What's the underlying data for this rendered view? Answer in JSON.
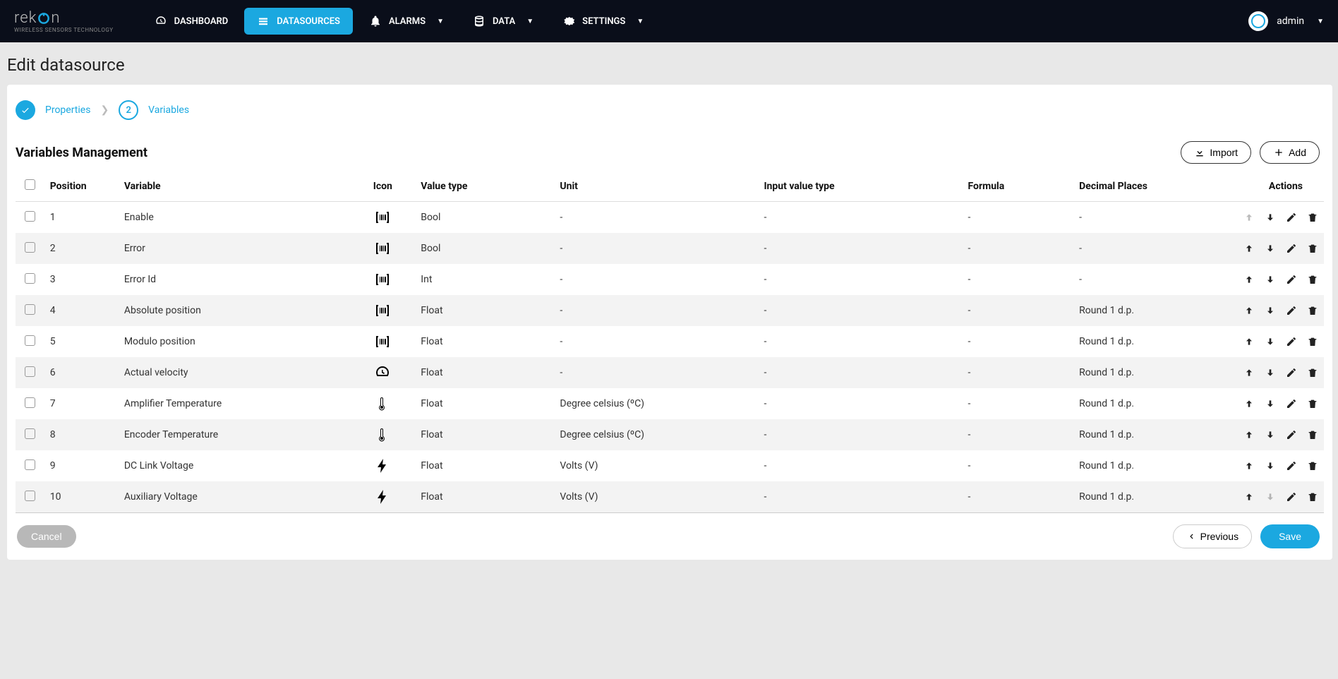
{
  "header": {
    "logo_main": "rekon",
    "logo_sub": "WIRELESS SENSORS TECHNOLOGY",
    "nav": [
      {
        "label": "DASHBOARD",
        "icon": "gauge",
        "dropdown": false,
        "active": false
      },
      {
        "label": "DATASOURCES",
        "icon": "datasource",
        "dropdown": false,
        "active": true
      },
      {
        "label": "ALARMS",
        "icon": "bell",
        "dropdown": true,
        "active": false
      },
      {
        "label": "DATA",
        "icon": "database",
        "dropdown": true,
        "active": false
      },
      {
        "label": "SETTINGS",
        "icon": "gear",
        "dropdown": true,
        "active": false
      }
    ],
    "user": "admin"
  },
  "page": {
    "title": "Edit datasource"
  },
  "stepper": {
    "step1_label": "Properties",
    "step2_num": "2",
    "step2_label": "Variables"
  },
  "section": {
    "title": "Variables Management",
    "import_label": "Import",
    "add_label": "Add"
  },
  "table": {
    "headers": {
      "position": "Position",
      "variable": "Variable",
      "icon": "Icon",
      "value_type": "Value type",
      "unit": "Unit",
      "input_value_type": "Input value type",
      "formula": "Formula",
      "decimal_places": "Decimal Places",
      "actions": "Actions"
    },
    "rows": [
      {
        "position": "1",
        "variable": "Enable",
        "icon": "barcode",
        "value_type": "Bool",
        "unit": "-",
        "input_value_type": "-",
        "formula": "-",
        "decimal_places": "-",
        "up_disabled": true,
        "down_disabled": false
      },
      {
        "position": "2",
        "variable": "Error",
        "icon": "barcode",
        "value_type": "Bool",
        "unit": "-",
        "input_value_type": "-",
        "formula": "-",
        "decimal_places": "-",
        "up_disabled": false,
        "down_disabled": false
      },
      {
        "position": "3",
        "variable": "Error Id",
        "icon": "barcode",
        "value_type": "Int",
        "unit": "-",
        "input_value_type": "-",
        "formula": "-",
        "decimal_places": "-",
        "up_disabled": false,
        "down_disabled": false
      },
      {
        "position": "4",
        "variable": "Absolute position",
        "icon": "barcode",
        "value_type": "Float",
        "unit": "-",
        "input_value_type": "-",
        "formula": "-",
        "decimal_places": "Round 1 d.p.",
        "up_disabled": false,
        "down_disabled": false
      },
      {
        "position": "5",
        "variable": "Modulo position",
        "icon": "barcode",
        "value_type": "Float",
        "unit": "-",
        "input_value_type": "-",
        "formula": "-",
        "decimal_places": "Round 1 d.p.",
        "up_disabled": false,
        "down_disabled": false
      },
      {
        "position": "6",
        "variable": "Actual velocity",
        "icon": "gauge",
        "value_type": "Float",
        "unit": "-",
        "input_value_type": "-",
        "formula": "-",
        "decimal_places": "Round 1 d.p.",
        "up_disabled": false,
        "down_disabled": false
      },
      {
        "position": "7",
        "variable": "Amplifier Temperature",
        "icon": "thermo",
        "value_type": "Float",
        "unit": "Degree celsius (ºC)",
        "input_value_type": "-",
        "formula": "-",
        "decimal_places": "Round 1 d.p.",
        "up_disabled": false,
        "down_disabled": false
      },
      {
        "position": "8",
        "variable": "Encoder Temperature",
        "icon": "thermo",
        "value_type": "Float",
        "unit": "Degree celsius (ºC)",
        "input_value_type": "-",
        "formula": "-",
        "decimal_places": "Round 1 d.p.",
        "up_disabled": false,
        "down_disabled": false
      },
      {
        "position": "9",
        "variable": "DC Link Voltage",
        "icon": "bolt",
        "value_type": "Float",
        "unit": "Volts (V)",
        "input_value_type": "-",
        "formula": "-",
        "decimal_places": "Round 1 d.p.",
        "up_disabled": false,
        "down_disabled": false
      },
      {
        "position": "10",
        "variable": "Auxiliary Voltage",
        "icon": "bolt",
        "value_type": "Float",
        "unit": "Volts (V)",
        "input_value_type": "-",
        "formula": "-",
        "decimal_places": "Round 1 d.p.",
        "up_disabled": false,
        "down_disabled": true
      }
    ]
  },
  "footer": {
    "cancel": "Cancel",
    "previous": "Previous",
    "save": "Save"
  }
}
